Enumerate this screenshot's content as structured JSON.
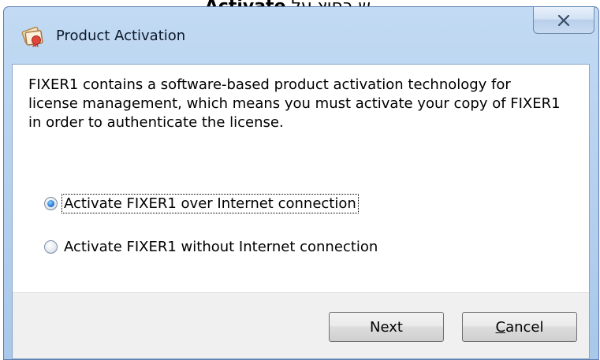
{
  "background": {
    "heading_prefix": "ש רחוץ על ",
    "heading_bold": "Activate",
    "heading_suffix": " ."
  },
  "window": {
    "title": "Product Activation",
    "close_glyph": "✕",
    "app_icon": "product-activation-icon"
  },
  "content": {
    "description": "FIXER1 contains a software-based product activation technology for license management, which means you must activate your copy of FIXER1 in order to authenticate the license."
  },
  "options": [
    {
      "label": "Activate FIXER1 over Internet connection",
      "selected": true
    },
    {
      "label": "Activate FIXER1 without Internet connection",
      "selected": false
    }
  ],
  "buttons": {
    "next_label": "Next",
    "cancel_mnemonic": "C",
    "cancel_rest": "ancel"
  },
  "colors": {
    "titlebar": "#b3cfee",
    "footer": "#f0f0f0",
    "radio_selected": "#2f7fd6"
  }
}
